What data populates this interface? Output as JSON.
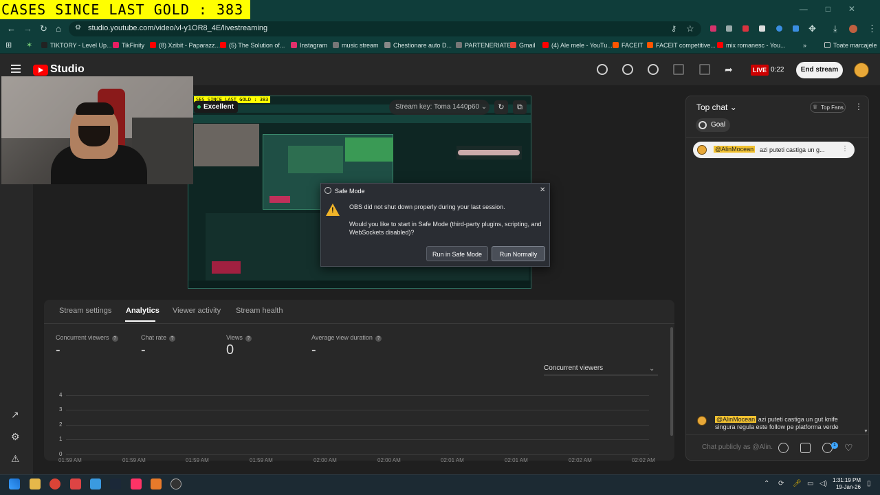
{
  "overlay": {
    "text": "CASES SINCE LAST GOLD : 383"
  },
  "browser": {
    "url": "studio.youtube.com/video/vl-y1OR8_4E/livestreaming",
    "bookmarks": [
      {
        "label": "TIKTORY - Level Up...",
        "color": "#222222"
      },
      {
        "label": "TikFinity",
        "color": "#e91e63"
      },
      {
        "label": "(8) Xzibit - Paparazz...",
        "color": "#ff0000"
      },
      {
        "label": "(5) The Solution of...",
        "color": "#ff0000"
      },
      {
        "label": "Instagram",
        "color": "#e1306c"
      },
      {
        "label": "music stream",
        "color": "#777777"
      },
      {
        "label": "Chestionare auto D...",
        "color": "#888888"
      },
      {
        "label": "PARTENERIATE",
        "color": "#777777"
      },
      {
        "label": "Gmail",
        "color": "#ea4335"
      },
      {
        "label": "(4) Ale mele - YouTu...",
        "color": "#ff0000"
      },
      {
        "label": "FACEIT",
        "color": "#ff5500"
      },
      {
        "label": "FACEIT competitive...",
        "color": "#ff5500"
      },
      {
        "label": "mix romanesc - You...",
        "color": "#ff0000"
      }
    ],
    "all_bookmarks": "Toate marcajele"
  },
  "studio": {
    "logo_text": "Studio",
    "live_badge": "LIVE",
    "live_time": "0:22",
    "end_stream": "End stream"
  },
  "preview": {
    "inner_overlay": "SES SINCE LAST GOLD : 383",
    "quality": "Excellent",
    "stream_key": "Stream key: Toma 1440p60"
  },
  "dialog": {
    "title": "Safe Mode",
    "message1": "OBS did not shut down properly during your last session.",
    "message2": "Would you like to start in Safe Mode (third-party plugins, scripting, and WebSockets disabled)?",
    "btn_safe": "Run in Safe Mode",
    "btn_normal": "Run Normally"
  },
  "analytics": {
    "tabs": [
      "Stream settings",
      "Analytics",
      "Viewer activity",
      "Stream health"
    ],
    "metrics": [
      {
        "label": "Concurrent viewers",
        "value": "-"
      },
      {
        "label": "Chat rate",
        "value": "-"
      },
      {
        "label": "Views",
        "value": "0"
      },
      {
        "label": "Average view duration",
        "value": "-"
      }
    ],
    "select": "Concurrent viewers",
    "y_ticks": [
      "4",
      "3",
      "2",
      "1",
      "0"
    ],
    "x_ticks": [
      "01:59 AM",
      "01:59 AM",
      "01:59 AM",
      "01:59 AM",
      "02:00 AM",
      "02:00 AM",
      "02:01 AM",
      "02:01 AM",
      "02:02 AM",
      "02:02 AM"
    ]
  },
  "chat": {
    "title": "Top chat",
    "top_fans": "Top Fans",
    "goal": "Goal",
    "pinned_user": "@AlinMocean",
    "pinned_text": "azi puteti castiga un g...",
    "msg_user": "@AlinMocean",
    "msg_text": "azi puteti castiga un gut knife singura regula este follow pe platforma verde",
    "input_placeholder": "Chat publicly as @Alin...",
    "badge_count": "1"
  },
  "taskbar": {
    "time": "1:31:19 PM",
    "date": "19-Jan-26"
  }
}
